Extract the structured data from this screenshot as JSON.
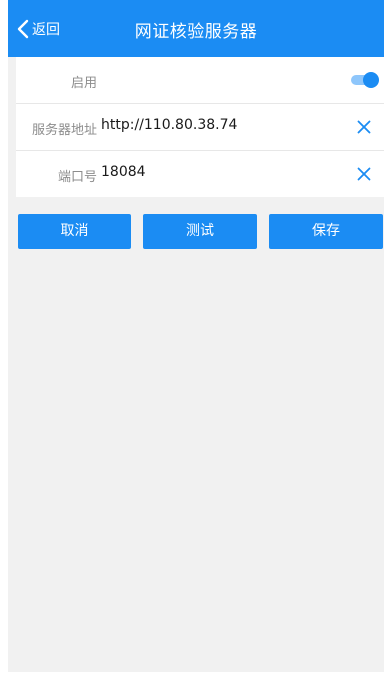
{
  "header": {
    "back_label": "返回",
    "title": "网证核验服务器"
  },
  "settings": {
    "enable": {
      "label": "启用",
      "on": true
    },
    "server_address": {
      "label": "服务器地址",
      "value": "http://110.80.38.74"
    },
    "port": {
      "label": "端口号",
      "value": "18084"
    }
  },
  "actions": {
    "cancel_label": "取消",
    "test_label": "测试",
    "save_label": "保存"
  },
  "colors": {
    "accent": "#1b8cf3",
    "background": "#f1f1f1"
  },
  "icons": {
    "back": "chevron-left-icon",
    "clear": "close-icon"
  }
}
